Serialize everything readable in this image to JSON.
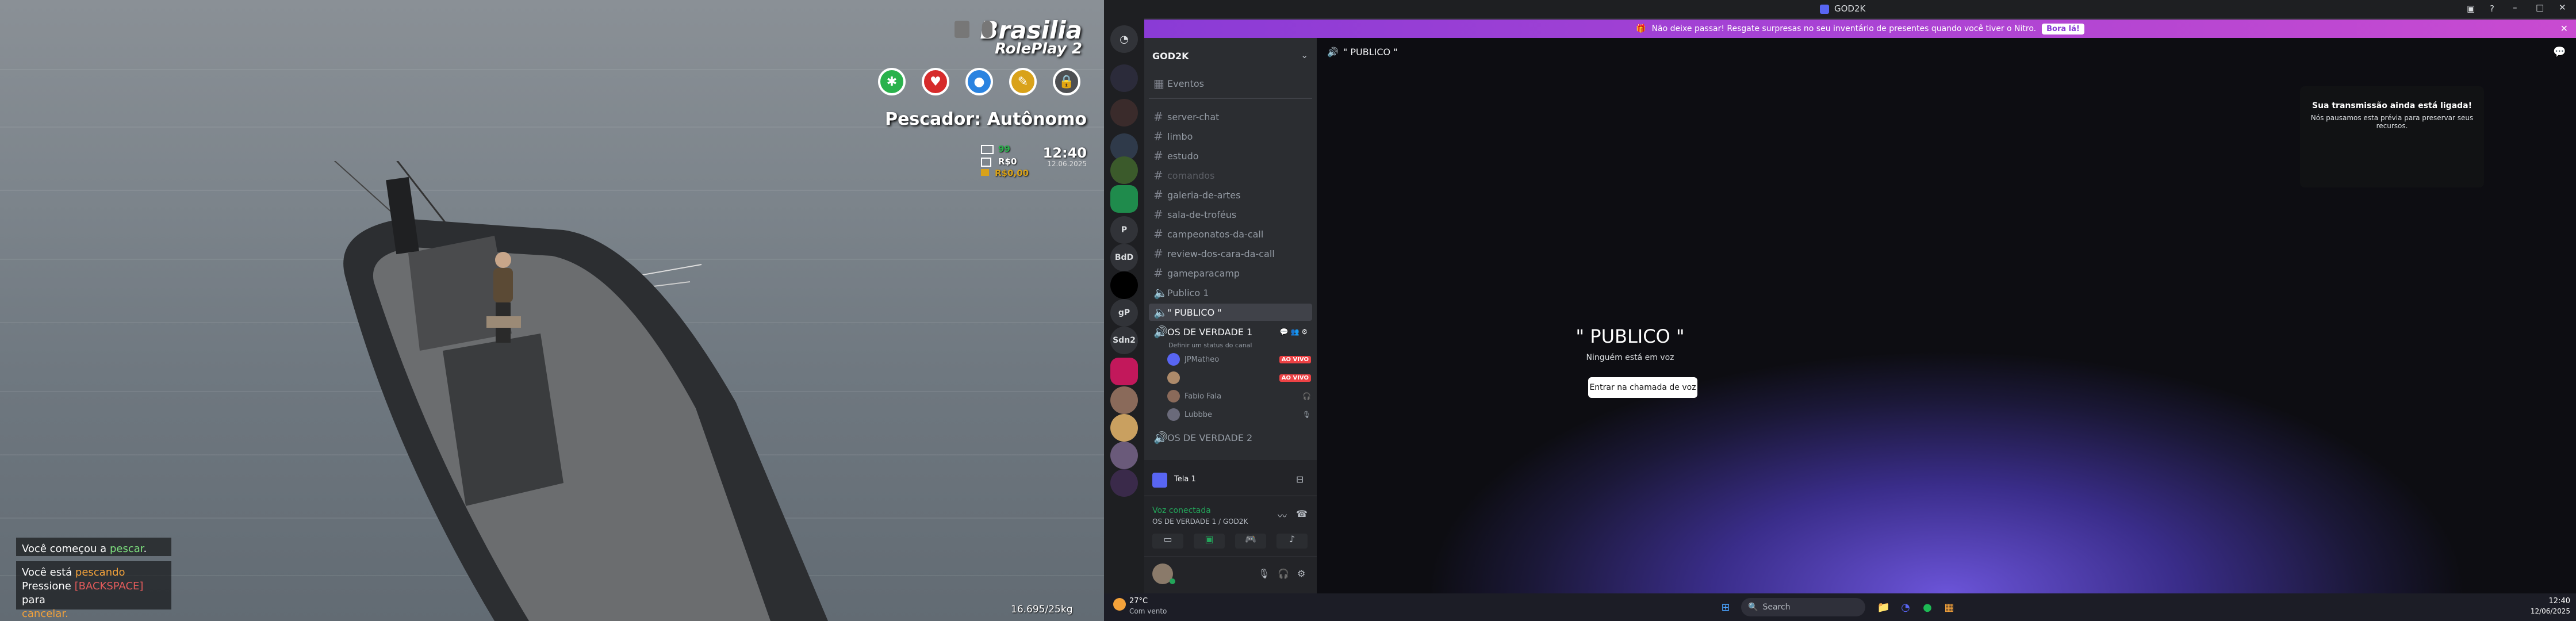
{
  "game": {
    "brand_title": "Brasilia",
    "brand_subtitle": "RolePlay 2",
    "job_label": "Pescador: Autônomo",
    "stat_hunger": "99",
    "stat_money": "R$0",
    "stat_extra": "R$0,00",
    "time": "12:40",
    "date": "12.06.2025",
    "weight": "16.695/25kg",
    "chat_line1_prefix": "Você começou a ",
    "chat_line1_highlight": "pescar",
    "chat_line1_suffix": ".",
    "chat_line2_prefix": "Você está ",
    "chat_line2_highlight": "pescando",
    "chat_line3_prefix": "Pressione ",
    "chat_line3_key": "[BACKSPACE]",
    "chat_line3_suffix": " para",
    "chat_line4": "cancelar.",
    "colors": {
      "green": "#2ab24c",
      "red": "#d62b2b",
      "blue": "#2a83e0",
      "gold": "#d9a21a",
      "gray": "#4d4f52"
    }
  },
  "discord": {
    "window_title": "GOD2K",
    "banner_text": "Não deixe passar! Resgate surpresas no seu inventário de presentes quando você tiver o Nitro.",
    "banner_button": "Bora lá!",
    "server_name": "GOD2K",
    "events": "Eventos",
    "servers": [
      "P",
      "BdD",
      "gP",
      "Sdn2"
    ],
    "text_channels": [
      "server-chat",
      "limbo",
      "estudo",
      "comandos",
      "galeria-de-artes",
      "sala-de-troféus",
      "campeonatos-da-call",
      "review-dos-cara-da-call",
      "gameparacamp"
    ],
    "voice_publico1": "Publico 1",
    "voice_publico": "\" PUBLICO \"",
    "voice_osdeverdade1": "OS DE VERDADE 1",
    "voice_status_hint": "Definir um status do canal",
    "voice_users": [
      {
        "name": "JPMatheo",
        "live": "AO VIVO"
      },
      {
        "name": "",
        "live": "AO VIVO"
      },
      {
        "name": "Fabio Fala",
        "live": ""
      },
      {
        "name": "Lubbbe",
        "live": ""
      }
    ],
    "voice_osdeverdade2": "OS DE VERDADE 2",
    "screen_share_label": "Tela 1",
    "voice_connected": "Voz conectada",
    "voice_connected_where": "OS DE VERDADE 1 / GOD2K",
    "main_header": "\" PUBLICO \"",
    "main_title": "\" PUBLICO \"",
    "main_subtitle": "Ninguém está em voz",
    "join_button": "Entrar na chamada de voz",
    "notice_title": "Sua transmissão ainda está ligada!",
    "notice_body": "Nós pausamos esta prévia para preservar seus recursos.",
    "colors": {
      "accent": "#5865f2",
      "live": "#ed4245",
      "connected": "#23a55a"
    }
  },
  "taskbar": {
    "weather_temp": "27°C",
    "weather_desc": "Com vento",
    "search_placeholder": "Search",
    "clock_time": "12:40",
    "clock_date": "12/06/2025"
  }
}
